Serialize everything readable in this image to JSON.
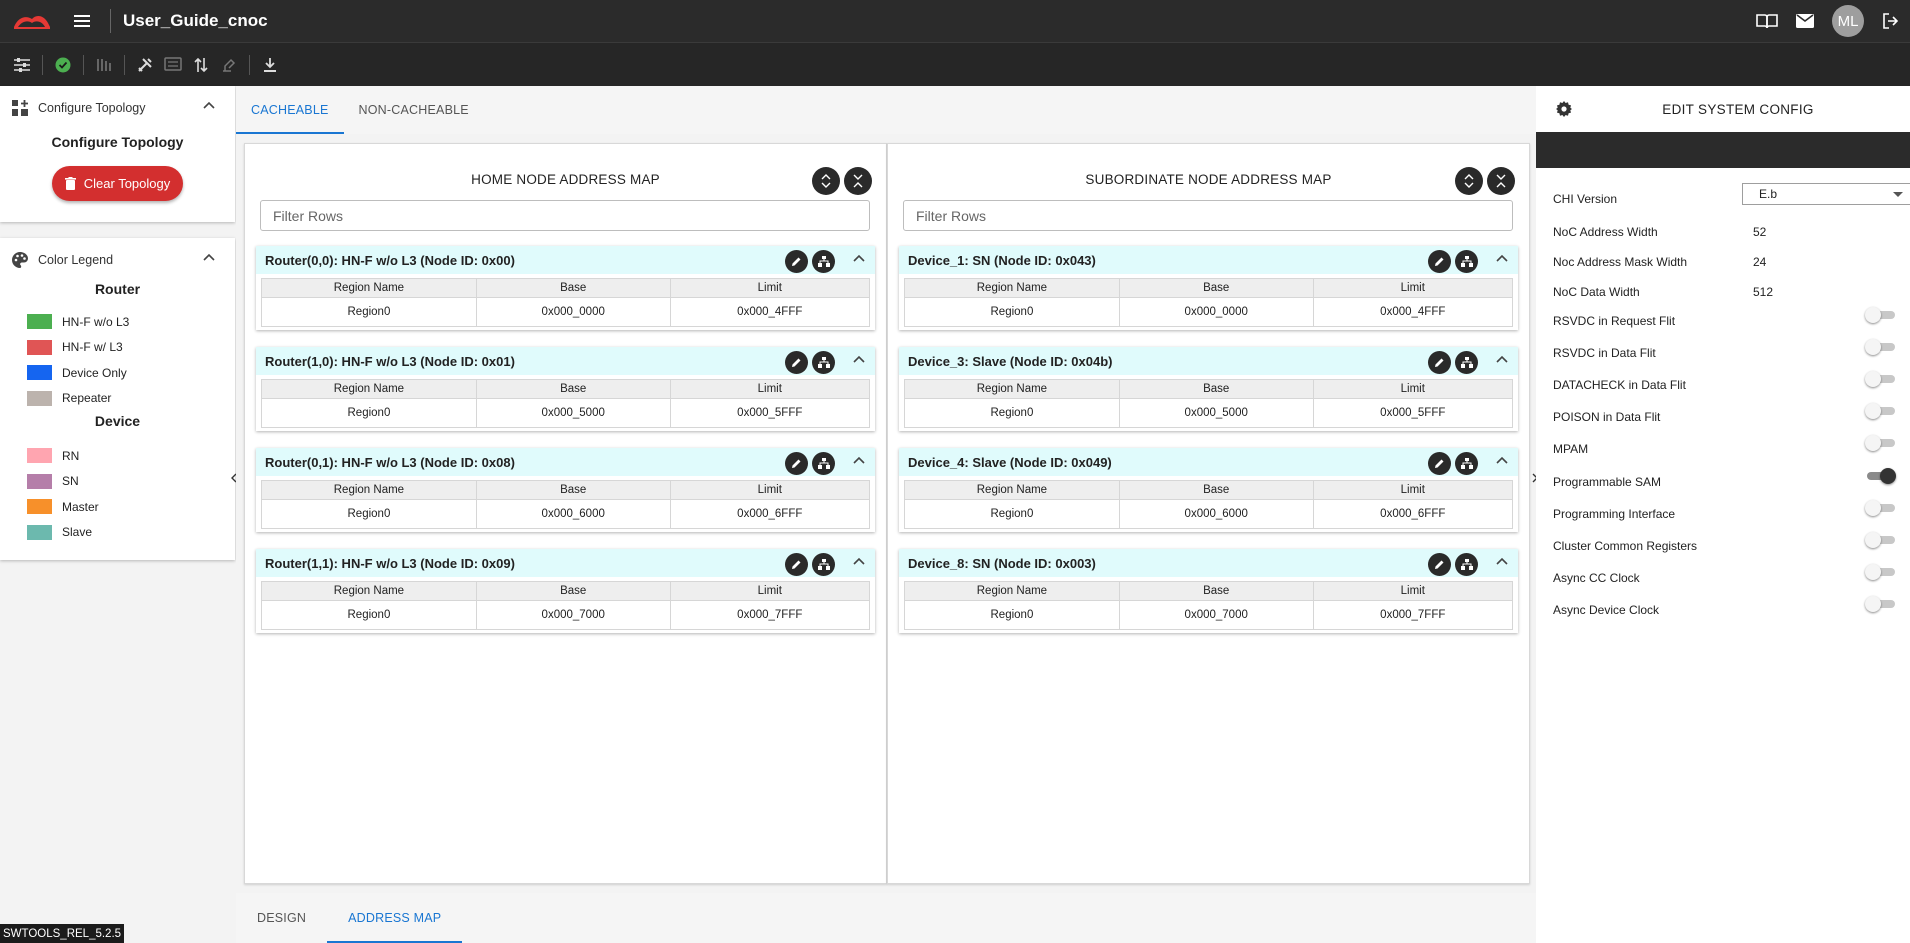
{
  "app": {
    "title": "User_Guide_cnoc",
    "avatar_initials": "ML",
    "version": "SWTOOLS_REL_5.2.5"
  },
  "colors": {
    "accent": "#1976d2",
    "danger": "#d32f2f",
    "node_header": "#e0fbfc"
  },
  "left": {
    "topology": {
      "header": "Configure Topology",
      "title": "Configure Topology",
      "clear_button": "Clear Topology"
    },
    "legend": {
      "header": "Color Legend",
      "router_group": "Router",
      "device_group": "Device",
      "router_items": [
        {
          "label": "HN-F w/o L3",
          "color": "#4caf50"
        },
        {
          "label": "HN-F w/ L3",
          "color": "#e05555"
        },
        {
          "label": "Device Only",
          "color": "#1565f0"
        },
        {
          "label": "Repeater",
          "color": "#bcb3ad"
        }
      ],
      "device_items": [
        {
          "label": "RN",
          "color": "#ffa5b0"
        },
        {
          "label": "SN",
          "color": "#b57ea9"
        },
        {
          "label": "Master",
          "color": "#f7902a"
        },
        {
          "label": "Slave",
          "color": "#6cb9ae"
        }
      ]
    }
  },
  "tabs_top": [
    "CACHEABLE",
    "NON-CACHEABLE"
  ],
  "tabs_bottom": [
    "DESIGN",
    "ADDRESS MAP"
  ],
  "table_headers": [
    "Region Name",
    "Base",
    "Limit"
  ],
  "home_map": {
    "title": "HOME NODE ADDRESS MAP",
    "filter_placeholder": "Filter Rows",
    "nodes": [
      {
        "header": "Router(0,0): HN-F w/o L3 (Node ID: 0x00)",
        "region": "Region0",
        "base": "0x000_0000",
        "limit": "0x000_4FFF"
      },
      {
        "header": "Router(1,0): HN-F w/o L3 (Node ID: 0x01)",
        "region": "Region0",
        "base": "0x000_5000",
        "limit": "0x000_5FFF"
      },
      {
        "header": "Router(0,1): HN-F w/o L3 (Node ID: 0x08)",
        "region": "Region0",
        "base": "0x000_6000",
        "limit": "0x000_6FFF"
      },
      {
        "header": "Router(1,1): HN-F w/o L3 (Node ID: 0x09)",
        "region": "Region0",
        "base": "0x000_7000",
        "limit": "0x000_7FFF"
      }
    ]
  },
  "sub_map": {
    "title": "SUBORDINATE NODE ADDRESS MAP",
    "filter_placeholder": "Filter Rows",
    "nodes": [
      {
        "header": "Device_1: SN (Node ID: 0x043)",
        "region": "Region0",
        "base": "0x000_0000",
        "limit": "0x000_4FFF"
      },
      {
        "header": "Device_3: Slave (Node ID: 0x04b)",
        "region": "Region0",
        "base": "0x000_5000",
        "limit": "0x000_5FFF"
      },
      {
        "header": "Device_4: Slave (Node ID: 0x049)",
        "region": "Region0",
        "base": "0x000_6000",
        "limit": "0x000_6FFF"
      },
      {
        "header": "Device_8: SN (Node ID: 0x003)",
        "region": "Region0",
        "base": "0x000_7000",
        "limit": "0x000_7FFF"
      }
    ]
  },
  "system_config": {
    "title": "EDIT SYSTEM CONFIG",
    "chi_version": {
      "label": "CHI Version",
      "value": "E.b"
    },
    "values": [
      {
        "label": "NoC Address Width",
        "value": "52"
      },
      {
        "label": "Noc Address Mask Width",
        "value": "24"
      },
      {
        "label": "NoC Data Width",
        "value": "512"
      }
    ],
    "toggles": [
      {
        "label": "RSVDC in Request Flit",
        "on": false
      },
      {
        "label": "RSVDC in Data Flit",
        "on": false
      },
      {
        "label": "DATACHECK in Data Flit",
        "on": false
      },
      {
        "label": "POISON in Data Flit",
        "on": false
      },
      {
        "label": "MPAM",
        "on": false
      },
      {
        "label": "Programmable SAM",
        "on": true
      },
      {
        "label": "Programming Interface",
        "on": false
      },
      {
        "label": "Cluster Common Registers",
        "on": false
      },
      {
        "label": "Async CC Clock",
        "on": false
      },
      {
        "label": "Async Device Clock",
        "on": false
      }
    ]
  }
}
